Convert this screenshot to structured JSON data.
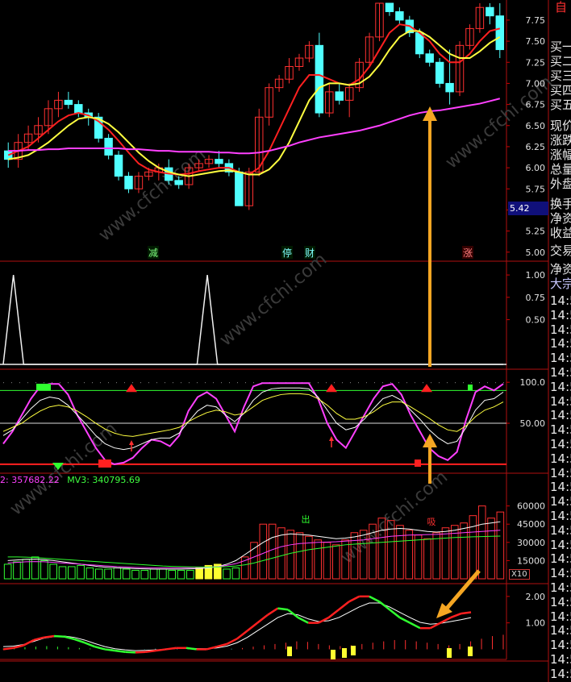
{
  "header": {
    "corner_label": "自"
  },
  "current_price": "5.42",
  "panel1": {
    "price_ticks": [
      "7.75",
      "7.50",
      "7.25",
      "7.00",
      "6.75",
      "6.50",
      "6.25",
      "6.00",
      "5.75",
      "5.50",
      "5.25",
      "5.00"
    ],
    "event_markers": [
      "减",
      "停",
      "财",
      "涨"
    ]
  },
  "panel2": {
    "ticks": [
      "1.00",
      "0.75",
      "0.50"
    ]
  },
  "panel3": {
    "ticks": [
      "100.0",
      "50.00"
    ]
  },
  "panel4": {
    "mv2_label": "2: 357682.22",
    "mv3_label": "MV3: 340795.69",
    "ticks": [
      "60000",
      "45000",
      "30000",
      "15000"
    ],
    "scale_label": "X10",
    "markers": [
      "出",
      "吸"
    ]
  },
  "panel5": {
    "ticks": [
      "2.00",
      "1.00"
    ]
  },
  "side_panel": {
    "labels": [
      "买一",
      "买二",
      "买三",
      "买四",
      "买五",
      "现价",
      "涨跌",
      "涨幅",
      "总量",
      "外盘",
      "换手",
      "净资",
      "收益",
      "交易",
      "净资",
      "大宗"
    ],
    "times": [
      "14:5",
      "14:5",
      "14:5",
      "14:5",
      "14:5",
      "14:5",
      "14:5",
      "14:5",
      "14:5",
      "14:5",
      "14:5",
      "14:5",
      "14:5",
      "14:5",
      "14:5",
      "14:5",
      "14:5",
      "14:5",
      "14:5",
      "14:5",
      "14:5",
      "14:5",
      "14:5",
      "14:5",
      "14:5",
      "14:5",
      "14:5"
    ]
  },
  "watermark": "www.cfchi.com",
  "colors": {
    "up": "#ff3030",
    "down": "#50ffff",
    "ma_red": "#ff2020",
    "ma_yellow": "#ffff40",
    "ma_magenta": "#ff40ff",
    "grid": "#b01010",
    "arrow": "#f5a623"
  },
  "chart_data": [
    {
      "type": "candlestick",
      "title": "",
      "ylim": [
        4.95,
        7.95
      ],
      "y_ticks": [
        5.0,
        5.25,
        5.5,
        5.75,
        6.0,
        6.25,
        6.5,
        6.75,
        7.0,
        7.25,
        7.5,
        7.75
      ],
      "ohlc": [
        [
          6.2,
          6.3,
          6.0,
          6.1
        ],
        [
          6.1,
          6.4,
          6.0,
          6.3
        ],
        [
          6.3,
          6.5,
          6.2,
          6.4
        ],
        [
          6.4,
          6.6,
          6.3,
          6.5
        ],
        [
          6.5,
          6.8,
          6.4,
          6.7
        ],
        [
          6.7,
          6.9,
          6.6,
          6.8
        ],
        [
          6.8,
          6.9,
          6.7,
          6.75
        ],
        [
          6.75,
          6.8,
          6.6,
          6.65
        ],
        [
          6.65,
          6.7,
          6.5,
          6.6
        ],
        [
          6.6,
          6.65,
          6.3,
          6.35
        ],
        [
          6.35,
          6.4,
          6.1,
          6.15
        ],
        [
          6.15,
          6.2,
          5.85,
          5.9
        ],
        [
          5.9,
          5.95,
          5.7,
          5.75
        ],
        [
          5.75,
          5.95,
          5.7,
          5.9
        ],
        [
          5.9,
          6.0,
          5.85,
          5.95
        ],
        [
          5.95,
          6.05,
          5.85,
          6.0
        ],
        [
          6.0,
          6.1,
          5.8,
          5.85
        ],
        [
          5.85,
          5.9,
          5.75,
          5.8
        ],
        [
          5.8,
          6.05,
          5.75,
          6.0
        ],
        [
          6.0,
          6.1,
          5.95,
          6.05
        ],
        [
          6.05,
          6.15,
          6.0,
          6.1
        ],
        [
          6.1,
          6.2,
          6.0,
          6.05
        ],
        [
          6.05,
          6.1,
          5.9,
          5.95
        ],
        [
          5.95,
          6.0,
          5.7,
          5.55
        ],
        [
          5.55,
          6.0,
          5.5,
          5.95
        ],
        [
          5.95,
          6.7,
          5.9,
          6.6
        ],
        [
          6.6,
          7.0,
          6.5,
          6.95
        ],
        [
          6.95,
          7.1,
          6.9,
          7.05
        ],
        [
          7.05,
          7.3,
          7.0,
          7.2
        ],
        [
          7.2,
          7.35,
          7.15,
          7.3
        ],
        [
          7.3,
          7.5,
          7.25,
          7.45
        ],
        [
          7.45,
          7.6,
          6.6,
          6.65
        ],
        [
          6.65,
          7.0,
          6.6,
          6.9
        ],
        [
          6.9,
          7.0,
          6.75,
          6.8
        ],
        [
          6.8,
          7.0,
          6.6,
          6.95
        ],
        [
          6.95,
          7.3,
          6.9,
          7.25
        ],
        [
          7.25,
          7.6,
          7.2,
          7.55
        ],
        [
          7.55,
          7.95,
          7.5,
          7.95
        ],
        [
          7.95,
          7.95,
          7.8,
          7.85
        ],
        [
          7.85,
          7.9,
          7.7,
          7.75
        ],
        [
          7.75,
          7.8,
          7.55,
          7.6
        ],
        [
          7.6,
          7.65,
          7.3,
          7.35
        ],
        [
          7.35,
          7.4,
          7.2,
          7.25
        ],
        [
          7.25,
          7.3,
          6.95,
          7.0
        ],
        [
          7.0,
          7.4,
          6.75,
          6.9
        ],
        [
          6.9,
          7.5,
          6.85,
          7.45
        ],
        [
          7.45,
          7.7,
          7.4,
          7.65
        ],
        [
          7.65,
          7.95,
          7.6,
          7.9
        ],
        [
          7.9,
          7.95,
          7.7,
          7.8
        ],
        [
          7.8,
          7.95,
          7.3,
          7.4
        ]
      ],
      "ma_series": [
        {
          "values": [
            6.15,
            6.2,
            6.25,
            6.35,
            6.45,
            6.55,
            6.62,
            6.65,
            6.62,
            6.55,
            6.45,
            6.32,
            6.18,
            6.05,
            5.98,
            5.95,
            5.93,
            5.92,
            5.93,
            5.96,
            5.98,
            6.0,
            6.0,
            5.95,
            5.92,
            6.0,
            6.2,
            6.45,
            6.7,
            6.95,
            7.1,
            7.1,
            7.05,
            7.0,
            6.98,
            7.05,
            7.2,
            7.4,
            7.6,
            7.7,
            7.68,
            7.6,
            7.5,
            7.35,
            7.25,
            7.25,
            7.35,
            7.5,
            7.62,
            7.65
          ]
        },
        {
          "values": [
            6.1,
            6.12,
            6.15,
            6.22,
            6.3,
            6.4,
            6.5,
            6.58,
            6.6,
            6.58,
            6.52,
            6.42,
            6.3,
            6.18,
            6.08,
            6.0,
            5.95,
            5.92,
            5.9,
            5.92,
            5.94,
            5.96,
            5.97,
            5.95,
            5.92,
            5.92,
            5.98,
            6.1,
            6.3,
            6.55,
            6.8,
            6.95,
            7.0,
            7.0,
            6.98,
            7.0,
            7.08,
            7.22,
            7.4,
            7.55,
            7.62,
            7.62,
            7.55,
            7.45,
            7.35,
            7.3,
            7.3,
            7.38,
            7.48,
            7.55
          ]
        },
        {
          "values": [
            6.2,
            6.2,
            6.21,
            6.21,
            6.22,
            6.22,
            6.23,
            6.23,
            6.23,
            6.23,
            6.23,
            6.23,
            6.22,
            6.22,
            6.21,
            6.2,
            6.2,
            6.19,
            6.19,
            6.19,
            6.19,
            6.18,
            6.18,
            6.17,
            6.17,
            6.18,
            6.2,
            6.23,
            6.26,
            6.3,
            6.33,
            6.36,
            6.38,
            6.4,
            6.42,
            6.44,
            6.47,
            6.5,
            6.54,
            6.58,
            6.62,
            6.65,
            6.67,
            6.68,
            6.7,
            6.72,
            6.74,
            6.76,
            6.79,
            6.82
          ]
        }
      ]
    },
    {
      "type": "line",
      "ylim": [
        0,
        1.1
      ],
      "y_ticks": [
        0.5,
        0.75,
        1.0
      ],
      "values": [
        0.0,
        1.0,
        0.0,
        0.0,
        0.0,
        0.0,
        0.0,
        0.0,
        0.0,
        0.0,
        0.0,
        0.0,
        0.0,
        0.0,
        0.0,
        0.0,
        0.0,
        0.0,
        0.0,
        0.0,
        1.0,
        0.0,
        0.0,
        0.0,
        0.0,
        0.0,
        0.0,
        0.0,
        0.0,
        0.0,
        0.0,
        0.0,
        0.0,
        0.0,
        0.0,
        0.0,
        0.0,
        0.0,
        0.0,
        0.0,
        0.0,
        0.0,
        0.0,
        0.0,
        0.0,
        0.0,
        0.0,
        0.0,
        0.0,
        0.0
      ]
    },
    {
      "type": "line",
      "ylim": [
        -5,
        110
      ],
      "y_ticks": [
        50,
        100
      ],
      "series": [
        {
          "values": [
            25,
            40,
            60,
            80,
            95,
            98,
            98,
            85,
            60,
            40,
            20,
            5,
            0,
            2,
            8,
            20,
            30,
            28,
            22,
            35,
            65,
            82,
            88,
            80,
            60,
            40,
            70,
            95,
            99,
            99,
            99,
            99,
            99,
            99,
            80,
            50,
            30,
            20,
            40,
            60,
            80,
            95,
            98,
            85,
            60,
            40,
            20,
            10,
            5,
            15,
            55,
            88,
            95,
            90,
            98
          ]
        },
        {
          "values": [
            35,
            42,
            55,
            68,
            78,
            82,
            80,
            72,
            60,
            48,
            35,
            25,
            20,
            18,
            20,
            25,
            30,
            32,
            32,
            38,
            52,
            65,
            72,
            70,
            60,
            52,
            62,
            78,
            88,
            92,
            93,
            93,
            93,
            92,
            82,
            66,
            50,
            42,
            45,
            55,
            68,
            80,
            84,
            78,
            66,
            55,
            42,
            32,
            25,
            28,
            45,
            66,
            78,
            80,
            88
          ]
        },
        {
          "values": [
            40,
            45,
            50,
            58,
            65,
            70,
            72,
            70,
            65,
            58,
            50,
            43,
            38,
            35,
            34,
            36,
            38,
            40,
            42,
            45,
            52,
            58,
            63,
            66,
            64,
            60,
            62,
            70,
            78,
            82,
            85,
            86,
            86,
            85,
            80,
            72,
            62,
            55,
            55,
            58,
            64,
            72,
            76,
            76,
            70,
            63,
            56,
            48,
            42,
            40,
            47,
            58,
            66,
            70,
            76
          ]
        }
      ]
    },
    {
      "type": "bar",
      "ylim": [
        0,
        75000
      ],
      "y_ticks": [
        15000,
        30000,
        45000,
        60000
      ],
      "values": [
        12000,
        14000,
        16000,
        18000,
        15000,
        12000,
        10000,
        10000,
        11000,
        9000,
        8000,
        8000,
        9000,
        8000,
        7000,
        7000,
        8000,
        8000,
        7000,
        7000,
        7000,
        9000,
        11000,
        12000,
        8000,
        9000,
        18000,
        30000,
        45000,
        45000,
        42000,
        40000,
        38000,
        35000,
        32000,
        30000,
        28000,
        32000,
        38000,
        40000,
        45000,
        50000,
        48000,
        44000,
        40000,
        36000,
        33000,
        38000,
        42000,
        44000,
        46000,
        52000,
        60000,
        50000,
        55000
      ],
      "series": [
        {
          "values": [
            15000,
            15500,
            16000,
            16200,
            15800,
            15000,
            14000,
            13000,
            12000,
            11000,
            10000,
            9500,
            9000,
            8700,
            8400,
            8200,
            8000,
            8000,
            8000,
            8000,
            8200,
            8500,
            9000,
            10000,
            12000,
            15000,
            20000,
            25000,
            30000,
            34000,
            36000,
            37000,
            36500,
            36000,
            35000,
            34000,
            33000,
            33500,
            34500,
            36000,
            38000,
            40000,
            41000,
            41500,
            41000,
            40000,
            39000,
            38500,
            39000,
            40000,
            41500,
            43000,
            45000,
            46000,
            47000
          ]
        },
        {
          "values": [
            13000,
            13500,
            14000,
            14200,
            14000,
            13500,
            13000,
            12500,
            12000,
            11500,
            11000,
            10500,
            10000,
            9700,
            9400,
            9200,
            9000,
            9000,
            9000,
            9000,
            9100,
            9300,
            9600,
            10000,
            11000,
            12500,
            15000,
            18000,
            21000,
            24000,
            26500,
            28000,
            29000,
            29500,
            30000,
            30200,
            30500,
            31000,
            31500,
            32000,
            33000,
            34000,
            35000,
            35500,
            36000,
            36200,
            36400,
            36600,
            37000,
            37500,
            38000,
            38500,
            39000,
            39500,
            40000
          ]
        },
        {
          "values": [
            18000,
            18000,
            17800,
            17500,
            17000,
            16500,
            16000,
            15500,
            15000,
            14500,
            14000,
            13500,
            13000,
            12500,
            12000,
            11500,
            11000,
            10500,
            10200,
            10000,
            9800,
            9700,
            9700,
            9800,
            10000,
            10500,
            11500,
            13000,
            15000,
            17000,
            19000,
            21000,
            22500,
            24000,
            25000,
            26000,
            27000,
            28000,
            28500,
            29000,
            29500,
            30000,
            30500,
            31000,
            31500,
            32000,
            32500,
            33000,
            33500,
            34000,
            34300,
            34600,
            34800,
            35000,
            35200
          ]
        }
      ]
    },
    {
      "type": "line",
      "ylim": [
        -0.2,
        2.3
      ],
      "y_ticks": [
        1.0,
        2.0
      ],
      "series": [
        {
          "values": [
            0.0,
            0.05,
            0.15,
            0.35,
            0.45,
            0.5,
            0.48,
            0.38,
            0.25,
            0.1,
            0.0,
            -0.05,
            -0.1,
            -0.12,
            -0.1,
            -0.05,
            0.0,
            0.05,
            0.05,
            0.0,
            0.0,
            0.1,
            0.2,
            0.4,
            0.7,
            1.0,
            1.3,
            1.55,
            1.5,
            1.2,
            1.0,
            1.0,
            1.2,
            1.5,
            1.8,
            2.0,
            2.0,
            1.8,
            1.5,
            1.2,
            1.0,
            0.8,
            0.8,
            1.0,
            1.2,
            1.35,
            1.4
          ]
        },
        {
          "values": [
            0.1,
            0.12,
            0.18,
            0.3,
            0.42,
            0.48,
            0.5,
            0.45,
            0.35,
            0.22,
            0.1,
            0.02,
            -0.02,
            -0.05,
            -0.04,
            -0.02,
            0.0,
            0.03,
            0.04,
            0.03,
            0.02,
            0.05,
            0.12,
            0.25,
            0.45,
            0.7,
            0.95,
            1.2,
            1.35,
            1.3,
            1.15,
            1.05,
            1.08,
            1.2,
            1.4,
            1.6,
            1.75,
            1.75,
            1.6,
            1.4,
            1.2,
            1.02,
            0.95,
            0.98,
            1.05,
            1.12,
            1.2
          ]
        }
      ],
      "histogram": [
        0.02,
        0.05,
        0.08,
        0.1,
        0.12,
        0.1,
        0.08,
        0.05,
        0.03,
        0.02,
        0.01,
        0.0,
        0.0,
        0.01,
        0.02,
        0.03,
        0.03,
        0.02,
        0.01,
        0.0,
        0.0,
        0.02,
        0.05,
        0.1,
        0.15,
        0.2,
        0.25,
        0.3,
        0.28,
        0.2,
        0.15,
        0.12,
        0.15,
        0.2,
        0.25,
        0.3,
        0.35,
        0.35,
        0.3,
        0.25,
        0.2,
        0.15,
        0.2,
        0.3,
        0.4,
        0.5,
        0.55
      ]
    }
  ]
}
